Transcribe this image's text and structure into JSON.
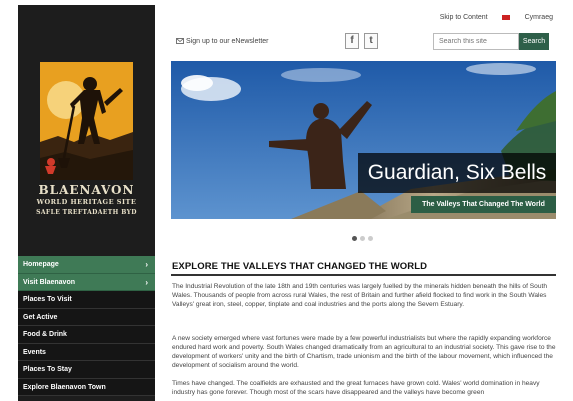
{
  "topbar": {
    "skip_label": "Skip to Content",
    "lang_label": "Cymraeg"
  },
  "newsletter": {
    "label": "Sign up to our eNewsletter",
    "icon": "envelope-icon"
  },
  "social": {
    "facebook": "f",
    "twitter": "t"
  },
  "search": {
    "placeholder": "Search this site",
    "button_label": "Search"
  },
  "logo": {
    "line1": "BLAENAVON",
    "line2": "WORLD HERITAGE SITE",
    "line3": "SAFLE TREFTADAETH BYD"
  },
  "nav": {
    "items": [
      {
        "label": "Homepage",
        "arrow": "›",
        "active": true
      },
      {
        "label": "Visit Blaenavon",
        "arrow": "›",
        "active": true
      },
      {
        "label": "Places To Visit",
        "arrow": "",
        "active": false
      },
      {
        "label": "Get Active",
        "arrow": "",
        "active": false
      },
      {
        "label": "Food & Drink",
        "arrow": "",
        "active": false
      },
      {
        "label": "Events",
        "arrow": "",
        "active": false
      },
      {
        "label": "Places To Stay",
        "arrow": "",
        "active": false
      },
      {
        "label": "Explore Blaenavon Town",
        "arrow": "",
        "active": false
      }
    ]
  },
  "hero": {
    "title": "Guardian, Six Bells",
    "subtitle": "The Valleys That Changed The World"
  },
  "carousel": {
    "slides": 3,
    "active": 1
  },
  "article": {
    "heading": "EXPLORE THE VALLEYS THAT CHANGED THE WORLD",
    "p1": "The Industrial Revolution of the late 18th and 19th centuries was largely fuelled by the minerals hidden beneath the hills of South Wales. Thousands of people from across rural Wales, the rest of Britain and further afield flocked to find work in the South Wales Valleys' great iron, steel, copper, tinplate and coal industries and the ports along the Severn Estuary.",
    "p2": "A new society emerged where vast fortunes were made by a few powerful industrialists but where the rapidly expanding workforce endured hard work and poverty. South Wales changed dramatically from an agricultural to an industrial society. This gave rise to the development of workers' unity and the birth of Chartism, trade unionism and the birth of the labour movement, which influenced the development of socialism around the world.",
    "p3": "Times have changed. The coalfields are exhausted and the great furnaces have grown cold. Wales' world domination in heavy industry has gone forever. Though most of the scars have disappeared and the valleys have become green"
  },
  "colors": {
    "sidebar": "#1d1d1d",
    "accent": "#3f7a56",
    "search_button": "#2e5f49",
    "logo_bg": "#e8a020"
  }
}
